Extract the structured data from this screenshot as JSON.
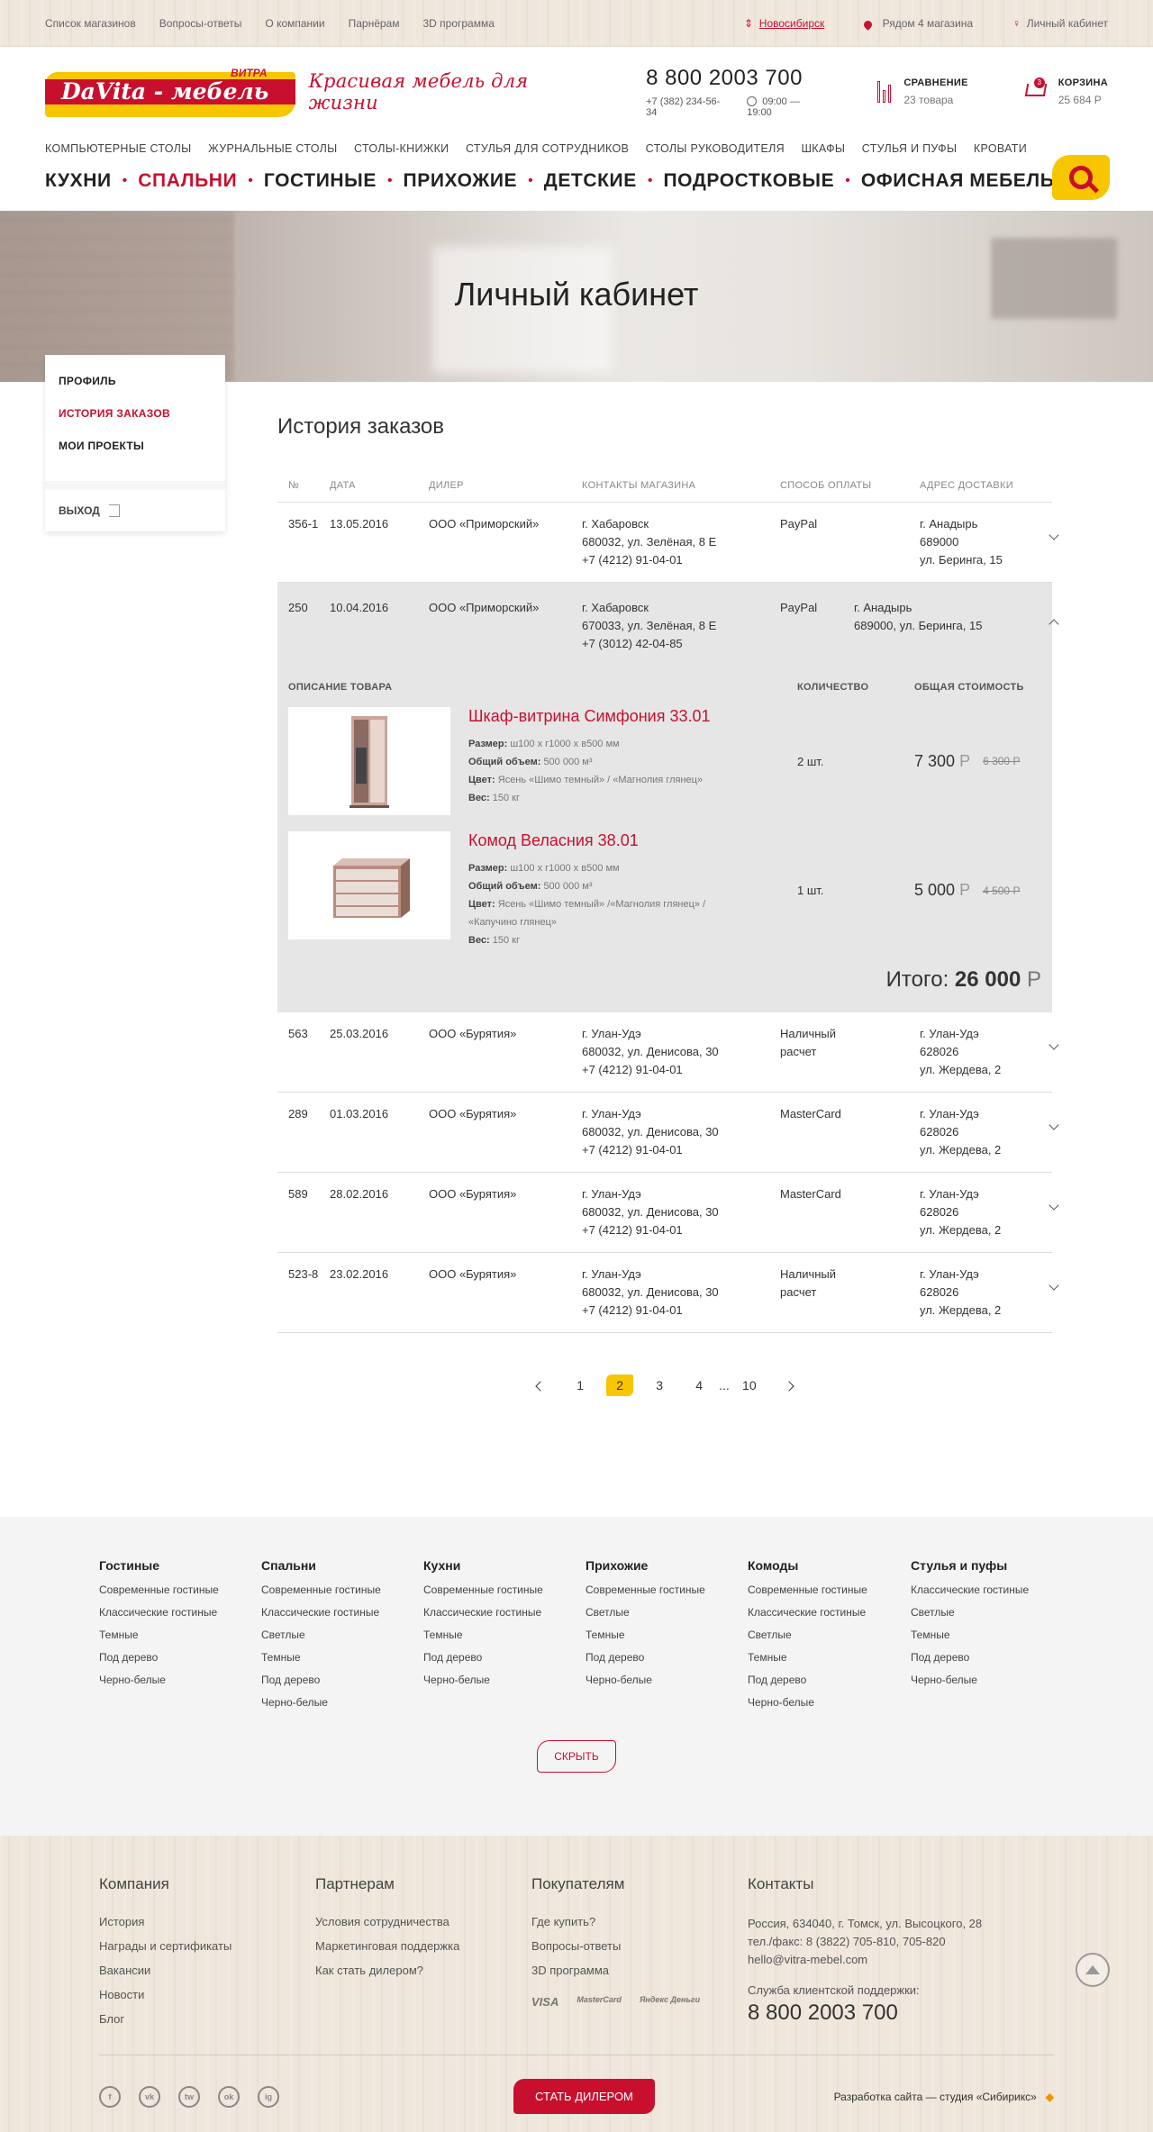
{
  "topbar": {
    "links": [
      "Список магазинов",
      "Вопросы-ответы",
      "О компании",
      "Парнёрам",
      "3D программа"
    ],
    "city": "Новосибирск",
    "near_stores": "Рядом 4 магазина",
    "account": "Личный кабинет"
  },
  "header": {
    "logo_text": "DaVita - мебель",
    "logo_factory": "ВИТРА",
    "slogan": "Красивая мебель для жизни",
    "phone_main": "8 800 2003 700",
    "phone_local": "+7 (382) 234-56-34",
    "hours": "09:00 — 19:00",
    "compare_label": "СРАВНЕНИЕ",
    "compare_count": "23 товара",
    "cart_label": "КОРЗИНА",
    "cart_sum": "25 684 Р",
    "cart_badge": "3"
  },
  "subnav": [
    "КОМПЬЮТЕРНЫЕ СТОЛЫ",
    "ЖУРНАЛЬНЫЕ СТОЛЫ",
    "СТОЛЫ-КНИЖКИ",
    "СТУЛЬЯ ДЛЯ СОТРУДНИКОВ",
    "СТОЛЫ РУКОВОДИТЕЛЯ",
    "ШКАФЫ",
    "СТУЛЬЯ И ПУФЫ",
    "КРОВАТИ"
  ],
  "mainnav": [
    "КУХНИ",
    "СПАЛЬНИ",
    "ГОСТИНЫЕ",
    "ПРИХОЖИЕ",
    "ДЕТСКИЕ",
    "ПОДРОСТКОВЫЕ",
    "ОФИСНАЯ МЕБЕЛЬ"
  ],
  "hero_title": "Личный кабинет",
  "sidebar": {
    "items": [
      "ПРОФИЛЬ",
      "ИСТОРИЯ ЗАКАЗОВ",
      "МОИ ПРОЕКТЫ"
    ],
    "exit": "ВЫХОД"
  },
  "orders": {
    "title": "История заказов",
    "headers": [
      "№",
      "ДАТА",
      "ДИЛЕР",
      "КОНТАКТЫ МАГАЗИНА",
      "СПОСОБ ОПЛАТЫ",
      "АДРЕС ДОСТАВКИ"
    ],
    "rows": [
      {
        "num": "356-1",
        "date": "13.05.2016",
        "dealer": "ООО «Приморский»",
        "contacts": [
          "г. Хабаровск",
          "680032, ул. Зелёная, 8 Е",
          "+7 (4212) 91-04-01"
        ],
        "payment": [
          "PayPal"
        ],
        "address": [
          "г. Анадырь",
          "689000",
          "ул. Беринга, 15"
        ]
      },
      {
        "num": "250",
        "date": "10.04.2016",
        "dealer": "ООО «Приморский»",
        "contacts": [
          "г. Хабаровск",
          "670033, ул. Зелёная, 8 Е",
          "+7 (3012) 42-04-85"
        ],
        "payment": [
          "PayPal"
        ],
        "address": [
          "г. Анадырь",
          "689000, ул. Беринга, 15"
        ]
      },
      {
        "num": "563",
        "date": "25.03.2016",
        "dealer": "ООО «Бурятия»",
        "contacts": [
          "г. Улан-Удэ",
          "680032,  ул. Денисова, 30",
          "+7 (4212) 91-04-01"
        ],
        "payment": [
          "Наличный",
          "расчет"
        ],
        "address": [
          "г. Улан-Удэ",
          "628026",
          "ул. Жердева, 2"
        ]
      },
      {
        "num": "289",
        "date": "01.03.2016",
        "dealer": "ООО «Бурятия»",
        "contacts": [
          "г. Улан-Удэ",
          "680032,  ул. Денисова, 30",
          "+7 (4212) 91-04-01"
        ],
        "payment": [
          "MasterCard"
        ],
        "address": [
          "г. Улан-Удэ",
          "628026",
          "ул. Жердева, 2"
        ]
      },
      {
        "num": "589",
        "date": "28.02.2016",
        "dealer": "ООО «Бурятия»",
        "contacts": [
          "г. Улан-Удэ",
          "680032,  ул. Денисова, 30",
          "+7 (4212) 91-04-01"
        ],
        "payment": [
          "MasterCard"
        ],
        "address": [
          "г. Улан-Удэ",
          "628026",
          "ул. Жердева, 2"
        ]
      },
      {
        "num": "523-8",
        "date": "23.02.2016",
        "dealer": "ООО «Бурятия»",
        "contacts": [
          "г. Улан-Удэ",
          "680032,  ул. Денисова, 30",
          "+7 (4212) 91-04-01"
        ],
        "payment": [
          "Наличный",
          "расчет"
        ],
        "address": [
          "г. Улан-Удэ",
          "628026",
          "ул. Жердева, 2"
        ]
      }
    ],
    "details": {
      "headers": [
        "ОПИСАНИЕ ТОВАРА",
        "КОЛИЧЕСТВО",
        "ОБЩАЯ СТОИМОСТЬ"
      ],
      "products": [
        {
          "name": "Шкаф-витрина Симфония 33.01",
          "size_label": "Размер:",
          "size": "ш100 х г1000 х в500 мм",
          "volume_label": "Общий объем:",
          "volume": "500 000 м³",
          "color_label": "Цвет:",
          "color": "Ясень «Шимо темный» / «Магнолия глянец»",
          "weight_label": "Вес:",
          "weight": "150 кг",
          "qty": "2 шт.",
          "price": "7 300",
          "old_price": "6 300 Р"
        },
        {
          "name": "Комод Веласния 38.01",
          "size_label": "Размер:",
          "size": "ш100 х г1000 х в500 мм",
          "volume_label": "Общий объем:",
          "volume": "500 000 м³",
          "color_label": "Цвет:",
          "color": "Ясень «Шимо темный» /«Магнолия глянец» / «Капучино глянец»",
          "weight_label": "Вес:",
          "weight": "150 кг",
          "qty": "1 шт.",
          "price": "5 000",
          "old_price": "4 500 Р"
        }
      ],
      "currency": "Р",
      "total_label": "Итого:",
      "total": "26 000"
    }
  },
  "pager": {
    "pages": [
      "1",
      "2",
      "3",
      "4",
      "...",
      "10"
    ],
    "current": "2"
  },
  "catalog": {
    "columns": [
      {
        "title": "Гостиные",
        "items": [
          "Современные гостиные",
          "Классические гостиные",
          "Темные",
          "Под дерево",
          "Черно-белые"
        ]
      },
      {
        "title": "Спальни",
        "items": [
          "Современные гостиные",
          "Классические гостиные",
          "Светлые",
          "Темные",
          "Под дерево",
          "Черно-белые"
        ]
      },
      {
        "title": "Кухни",
        "items": [
          "Современные гостиные",
          "Классические гостиные",
          "Темные",
          "Под дерево",
          "Черно-белые"
        ]
      },
      {
        "title": "Прихожие",
        "items": [
          "Современные гостиные",
          "Светлые",
          "Темные",
          "Под дерево",
          "Черно-белые"
        ]
      },
      {
        "title": "Комоды",
        "items": [
          "Современные гостиные",
          "Классические гостиные",
          "Светлые",
          "Темные",
          "Под дерево",
          "Черно-белые"
        ]
      },
      {
        "title": "Стулья и пуфы",
        "items": [
          "Классические гостиные",
          "Светлые",
          "Темные",
          "Под дерево",
          "Черно-белые"
        ]
      }
    ],
    "hide_button": "СКРЫТЬ"
  },
  "footer": {
    "columns": [
      {
        "title": "Компания",
        "items": [
          "История",
          "Награды и сертификаты",
          "Вакансии",
          "Новости",
          "Блог"
        ]
      },
      {
        "title": "Партнерам",
        "items": [
          "Условия сотрудничества",
          "Маркетинговая поддержка",
          "Как стать дилером?"
        ]
      },
      {
        "title": "Покупателям",
        "items": [
          "Где купить?",
          "Вопросы-ответы",
          "3D программа"
        ]
      }
    ],
    "contacts_title": "Контакты",
    "contacts": [
      "Россия, 634040, г. Томск, ул. Высоцкого, 28",
      "тел./факс: 8 (3822) 705-810, 705-820",
      "hello@vitra-mebel.com"
    ],
    "support_label": "Служба клиентской поддержки:",
    "support_phone": "8 800 2003 700",
    "payments": [
      "VISA",
      "MasterCard",
      "Яндекс Деньги"
    ],
    "social": [
      "f",
      "vk",
      "tw",
      "ok",
      "ig"
    ],
    "dealer_button": "СТАТЬ ДИЛЕРОМ",
    "developer": "Разработка сайта — студия «Сибирикс»"
  },
  "colors": {
    "accent": "#c8102e",
    "yellow": "#f7c600"
  }
}
